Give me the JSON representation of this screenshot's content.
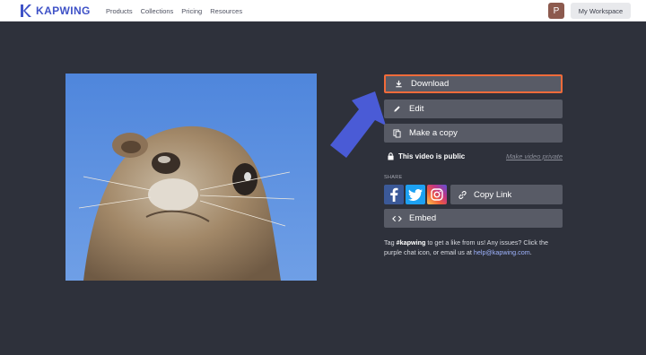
{
  "header": {
    "brand": "KAPWING",
    "nav": [
      "Products",
      "Collections",
      "Pricing",
      "Resources"
    ],
    "avatar_initial": "P",
    "workspace_label": "My Workspace"
  },
  "actions": {
    "download": "Download",
    "edit": "Edit",
    "make_copy": "Make a copy"
  },
  "visibility": {
    "status": "This video is public",
    "toggle_link": "Make video private"
  },
  "share": {
    "label": "SHARE",
    "copy_link": "Copy Link",
    "embed": "Embed"
  },
  "info": {
    "prefix": "Tag ",
    "hashtag": "#kapwing",
    "middle": " to get a like from us! Any issues? Click the purple chat icon, or email us at ",
    "email": "help@kapwing.com",
    "suffix": "."
  },
  "colors": {
    "background": "#2e313b",
    "button": "#585b66",
    "highlight_border": "#f26b3a",
    "arrow": "#4a5bd6",
    "brand": "#3f52c7"
  },
  "icons": [
    "download-icon",
    "pencil-icon",
    "copy-icon",
    "lock-icon",
    "facebook-icon",
    "twitter-icon",
    "instagram-icon",
    "link-icon",
    "code-icon"
  ]
}
